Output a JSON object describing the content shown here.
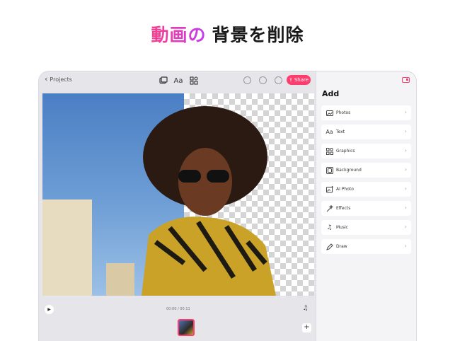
{
  "headline": {
    "accent": "動画の",
    "rest": "背景を削除"
  },
  "toolbar": {
    "back_label": "Projects",
    "text_tool": "Aa",
    "share_label": "Share",
    "icons": [
      "media-icon",
      "text-icon",
      "graphics-icon",
      "undo-icon",
      "redo-icon",
      "more-icon"
    ]
  },
  "timeline": {
    "time_code": "00:00 / 00:11"
  },
  "panel": {
    "title": "Add",
    "items": [
      {
        "label": "Photos",
        "icon": "photos-icon"
      },
      {
        "label": "Text",
        "icon": "text-icon"
      },
      {
        "label": "Graphics",
        "icon": "graphics-icon"
      },
      {
        "label": "Background",
        "icon": "background-icon"
      },
      {
        "label": "AI Photo",
        "icon": "ai-photo-icon"
      },
      {
        "label": "Effects",
        "icon": "effects-icon"
      },
      {
        "label": "Music",
        "icon": "music-icon"
      },
      {
        "label": "Draw",
        "icon": "draw-icon"
      }
    ]
  },
  "colors": {
    "accent": "#ff3c6d",
    "gradient_start": "#ff3d8b",
    "gradient_end": "#c03bf0"
  }
}
